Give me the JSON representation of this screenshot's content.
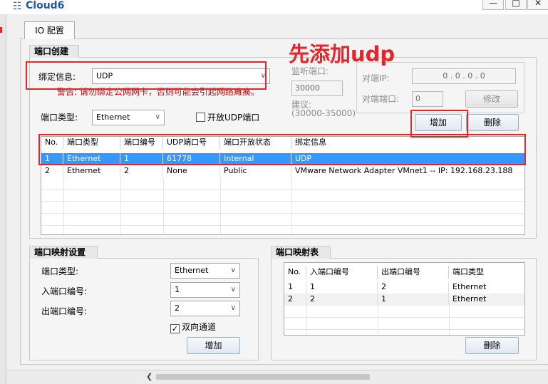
{
  "window": {
    "title": "Cloud6",
    "minimize_label": "—",
    "maximize_label": "□",
    "close_label": "✕"
  },
  "tabs": [
    {
      "label": "IO 配置"
    }
  ],
  "port_create": {
    "group_title": "端口创建",
    "bind_label": "绑定信息:",
    "bind_value": "UDP",
    "warning": "警告:   请勿绑定公网网卡，否则可能会引起网络瘫痪。",
    "listen_port_label": "监听端口:",
    "listen_port_value": "30000",
    "suggest_label": "建议:",
    "suggest_range": "(30000-35000)",
    "peer_ip_label": "对端IP:",
    "peer_ip_value": "0   .   0   .   0   .   0",
    "peer_port_label": "对端端口:",
    "peer_port_value": "0",
    "modify_label": "修改",
    "port_type_label": "端口类型:",
    "port_type_value": "Ethernet",
    "open_udp_label": "开放UDP端口",
    "open_udp_checked": false,
    "add_label": "增加",
    "delete_label": "删除",
    "table": {
      "headers": [
        "No.",
        "端口类型",
        "端口编号",
        "UDP端口号",
        "端口开放状态",
        "绑定信息"
      ],
      "rows": [
        [
          "1",
          "Ethernet",
          "1",
          "61778",
          "Internal",
          "UDP"
        ],
        [
          "2",
          "Ethernet",
          "2",
          "None",
          "Public",
          "VMware Network Adapter VMnet1 -- IP: 192.168.23.188"
        ]
      ],
      "selected_row": 0
    }
  },
  "port_mapping": {
    "group_title": "端口映射设置",
    "port_type_label": "端口类型:",
    "port_type_value": "Ethernet",
    "in_port_label": "入端口编号:",
    "in_port_value": "1",
    "out_port_label": "出端口编号:",
    "out_port_value": "2",
    "bidirectional_label": "双向通道",
    "bidirectional_checked": true,
    "add_label": "增加"
  },
  "mapping_table": {
    "group_title": "端口映射表",
    "headers": [
      "No.",
      "入端口编号",
      "出端口编号",
      "端口类型"
    ],
    "rows": [
      [
        "1",
        "1",
        "2",
        "Ethernet"
      ],
      [
        "2",
        "2",
        "1",
        "Ethernet"
      ]
    ],
    "delete_label": "删除"
  },
  "annotation": {
    "text": "先添加udp",
    "color": "#e3262b"
  },
  "colors": {
    "selection": "#3399ff",
    "accent": "#1e5aa8",
    "warning": "#d00000"
  }
}
